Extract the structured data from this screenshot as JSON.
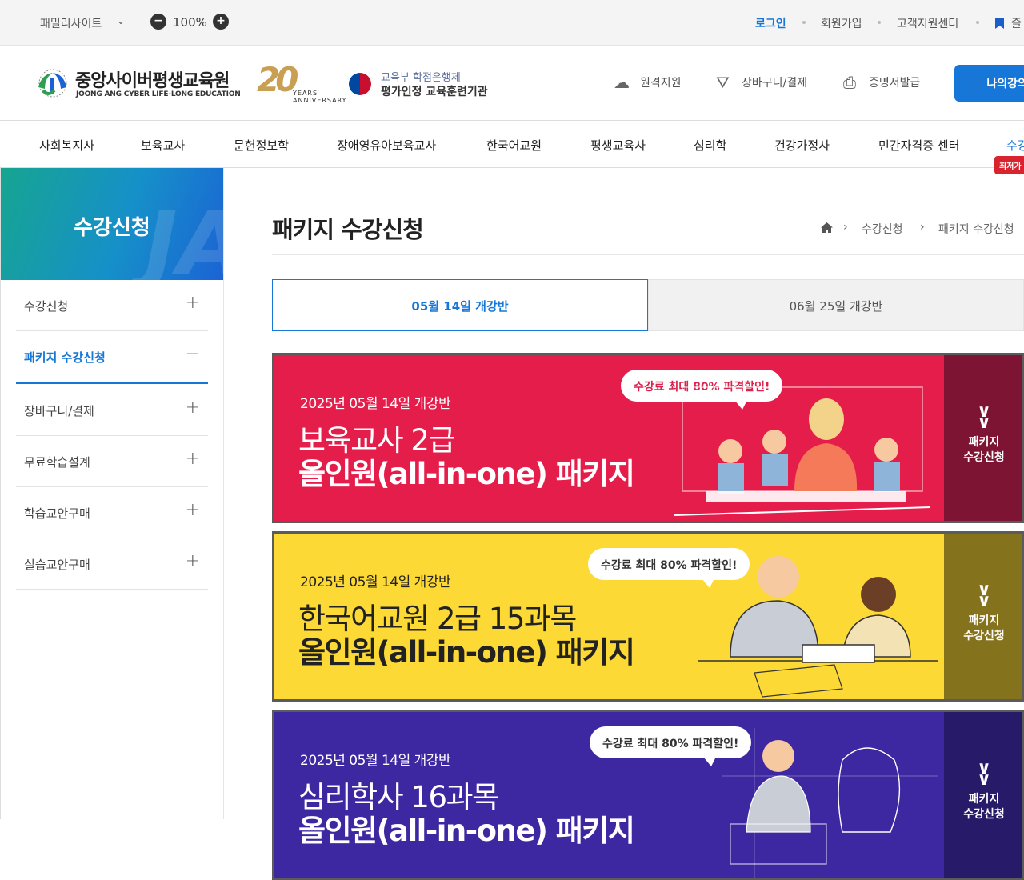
{
  "topbar": {
    "family_site": "패밀리사이트",
    "zoom": "100%",
    "login": "로그인",
    "signup": "회원가입",
    "support": "고객지원센터",
    "bookmark": "즐"
  },
  "header": {
    "logo_title": "중앙사이버평생교육원",
    "logo_sub": "JOONG ANG CYBER LIFE-LONG EDUCATION",
    "anniv_num": "20",
    "anniv_txt1": "YEARS",
    "anniv_txt2": "ANNIVERSARY",
    "moe_line1": "교육부 학점은행제",
    "moe_line2": "평가인정 교육훈련기관",
    "remote": "원격지원",
    "cart": "장바구니/결제",
    "cert": "증명서발급",
    "my": "나의강의"
  },
  "gnb": {
    "items": [
      "사회복지사",
      "보육교사",
      "문헌정보학",
      "장애영유아보육교사",
      "한국어교원",
      "평생교육사",
      "심리학",
      "건강가정사",
      "민간자격증 센터",
      "수강"
    ],
    "badge": "최저가"
  },
  "lnb": {
    "title": "수강신청",
    "items": [
      {
        "label": "수강신청",
        "sign": "+"
      },
      {
        "label": "패키지 수강신청",
        "sign": "−"
      },
      {
        "label": "장바구니/결제",
        "sign": "+"
      },
      {
        "label": "무료학습설계",
        "sign": "+"
      },
      {
        "label": "학습교안구매",
        "sign": "+"
      },
      {
        "label": "실습교안구매",
        "sign": "+"
      }
    ]
  },
  "main": {
    "title": "패키지 수강신청",
    "breadcrumb": [
      "수강신청",
      "패키지 수강신청"
    ],
    "tabs": [
      "05월 14일 개강반",
      "06월 25일 개강반"
    ],
    "banners": [
      {
        "date": "2025년 05월 14일 개강반",
        "line1": "보육교사 2급",
        "line2": "올인원(all-in-one) 패키지",
        "bubble": "수강료 최대 80% 파격할인!",
        "cta1": "패키지",
        "cta2": "수강신청"
      },
      {
        "date": "2025년 05월 14일 개강반",
        "line1": "한국어교원 2급 15과목",
        "line2": "올인원(all-in-one) 패키지",
        "bubble": "수강료 최대 80% 파격할인!",
        "cta1": "패키지",
        "cta2": "수강신청"
      },
      {
        "date": "2025년 05월 14일 개강반",
        "line1": "심리학사 16과목",
        "line2": "올인원(all-in-one) 패키지",
        "bubble": "수강료 최대 80% 파격할인!",
        "cta1": "패키지",
        "cta2": "수강신청"
      }
    ]
  },
  "colors": {
    "accent": "#1677d8",
    "banner_red": "#e51d4b",
    "banner_yellow": "#fcd934",
    "banner_purple": "#3d28a1"
  }
}
